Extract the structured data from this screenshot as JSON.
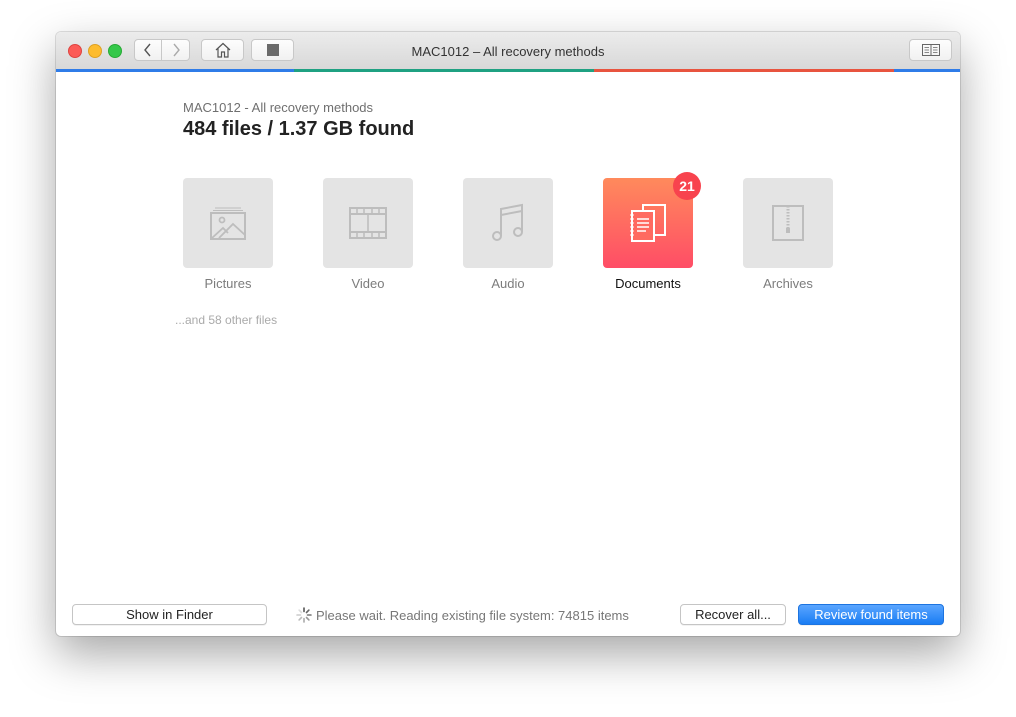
{
  "window": {
    "title": "MAC1012 – All recovery methods",
    "progress_bar_colors": [
      "#2f7ce8",
      "#1fa182",
      "#e8543f",
      "#2f7ce8"
    ]
  },
  "toolbar": {
    "back_icon": "chevron-left-icon",
    "forward_icon": "chevron-right-icon",
    "home_icon": "house-icon",
    "stop_icon": "stop-square-icon",
    "sidebar_icon": "book-columns-icon"
  },
  "header": {
    "source": "MAC1012 - All recovery methods",
    "summary": "484 files / 1.37 GB found"
  },
  "categories": [
    {
      "label": "Pictures",
      "icon": "picture-icon",
      "active": false
    },
    {
      "label": "Video",
      "icon": "film-strip-icon",
      "active": false
    },
    {
      "label": "Audio",
      "icon": "music-note-icon",
      "active": false
    },
    {
      "label": "Documents",
      "icon": "documents-icon",
      "active": true,
      "badge": "21"
    },
    {
      "label": "Archives",
      "icon": "zip-archive-icon",
      "active": false
    }
  ],
  "other_files": "...and 58 other files",
  "footer": {
    "show_in_finder": "Show in Finder",
    "status": "Please wait. Reading existing file system: 74815 items",
    "recover_all": "Recover all...",
    "review": "Review found items"
  },
  "colors": {
    "accent": "#1a7df3",
    "documents_gradient_top": "#ff8a5c",
    "documents_gradient_bottom": "#ff4d66",
    "badge": "#f8434e"
  }
}
